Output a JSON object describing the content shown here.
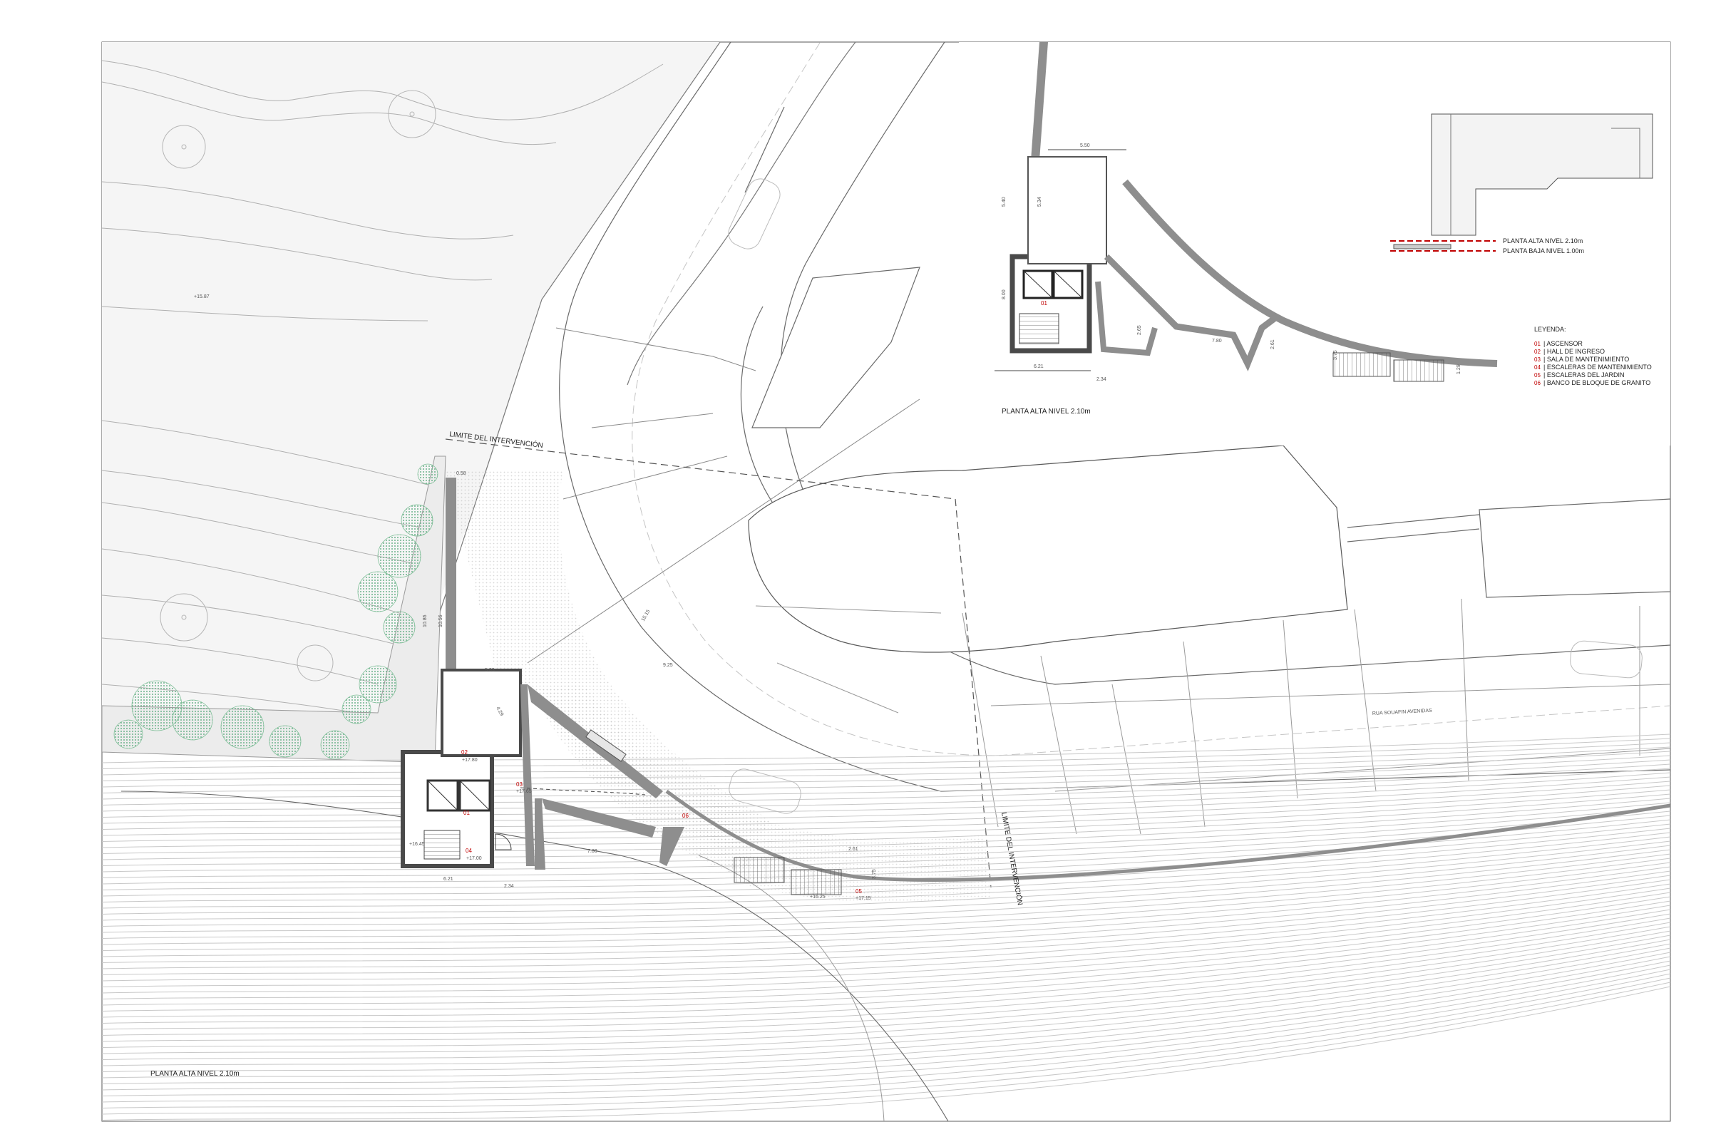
{
  "titles": {
    "main_plan": "PLANTA ALTA NIVEL 2.10m",
    "inset_plan": "PLANTA ALTA NIVEL 2.10m"
  },
  "boundary_label": "LIMITE DEL INTERVENCIÓN",
  "section_key": {
    "upper": "PLANTA ALTA NIVEL 2.10m",
    "lower": "PLANTA BAJA NIVEL 1.00m"
  },
  "legend": {
    "title": "LEYENDA:",
    "items": [
      {
        "num": "01",
        "text": "| ASCENSOR"
      },
      {
        "num": "02",
        "text": "| HALL DE INGRESO"
      },
      {
        "num": "03",
        "text": "| SALA DE MANTENIMIENTO"
      },
      {
        "num": "04",
        "text": "| ESCALERAS DE MANTENIMIENTO"
      },
      {
        "num": "05",
        "text": "| ESCALERAS DEL JARDIN"
      },
      {
        "num": "06",
        "text": "| BANCO DE BLOQUE DE GRANITO"
      }
    ],
    "num_color": "#c00000"
  },
  "main_dimensions": {
    "d_058": "0.58",
    "d_533": "5.33",
    "d_1086": "10.86",
    "d_1056": "10.56",
    "d_621": "6.21",
    "d_234": "2.34",
    "d_780": "7.80",
    "d_265": "2.65",
    "d_375": "3.75",
    "d_261": "2.61",
    "d_925": "9.25",
    "d_1515": "15.15",
    "d_1092": "10.92",
    "d_1050": "10.50",
    "d_429": "4.29",
    "d_621b": "6.21"
  },
  "levels": {
    "lv_1780": "+17.80",
    "lv_1765": "+17.65",
    "lv_1645": "+16.45",
    "lv_1700": "+17.00",
    "lv_1625": "+16.25",
    "lv_1715": "+17.15",
    "lv_1587": "+15.87"
  },
  "room_tags": {
    "t01": "01",
    "t02": "02",
    "t03": "03",
    "t04": "04",
    "t05": "05",
    "t06": "06"
  },
  "inset_dimensions": {
    "i_550": "5.50",
    "i_540": "5.40",
    "i_534": "5.34",
    "i_800": "8.00",
    "i_621": "6.21",
    "i_234": "2.34",
    "i_265": "2.65",
    "i_780": "7.80",
    "i_375": "3.75",
    "i_261": "2.61",
    "i_129": "1.29"
  },
  "street_label": "RUA SOUAFIN AVENIDAS",
  "colors": {
    "line": "#4a4a4a",
    "thin": "#9a9a9a",
    "wall": "#8e8e8e",
    "vegetation": "#7fbf98",
    "paving": "#d8d8d8",
    "accent_red": "#c00000"
  }
}
